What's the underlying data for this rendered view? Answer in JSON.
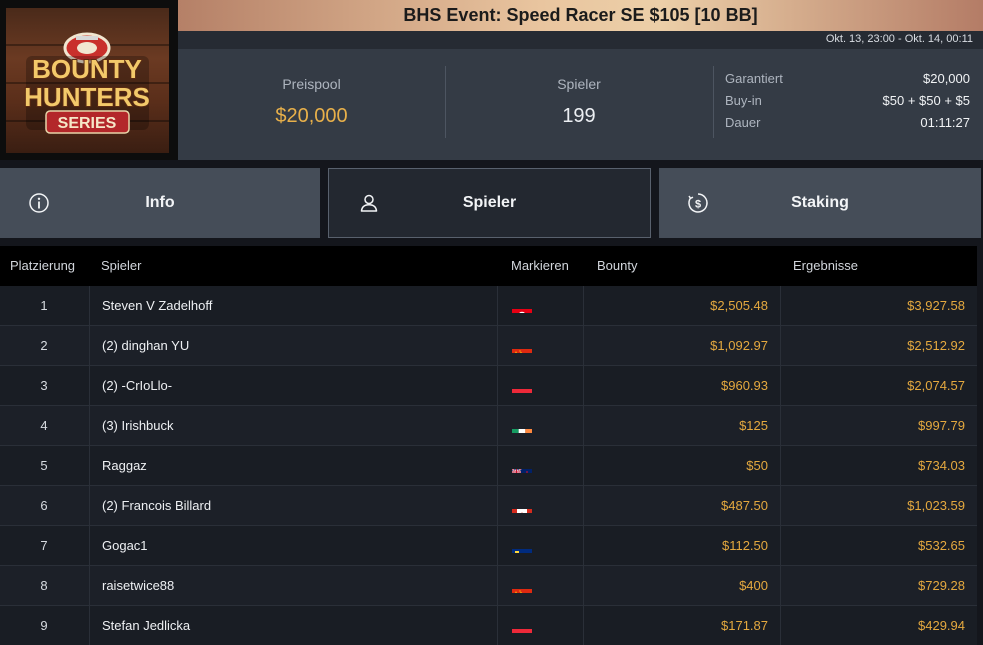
{
  "logo": {
    "line1": "BOUNTY",
    "line2": "HUNTERS",
    "line3": "SERIES"
  },
  "header": {
    "title": "BHS Event: Speed Racer SE $105 [10 BB]",
    "date_range": "Okt. 13, 23:00 - Okt. 14, 00:11"
  },
  "summary": {
    "prizepool_label": "Preispool",
    "prizepool_value": "$20,000",
    "players_label": "Spieler",
    "players_value": "199",
    "details": [
      {
        "label": "Garantiert",
        "value": "$20,000"
      },
      {
        "label": "Buy-in",
        "value": "$50 + $50 + $5"
      },
      {
        "label": "Dauer",
        "value": "01:11:27"
      }
    ]
  },
  "tabs": [
    {
      "label": "Info",
      "icon": "info-icon",
      "active": false
    },
    {
      "label": "Spieler",
      "icon": "user-icon",
      "active": true
    },
    {
      "label": "Staking",
      "icon": "dollar-coin-icon",
      "active": false
    }
  ],
  "table": {
    "headers": [
      "Platzierung",
      "Spieler",
      "Markieren",
      "Bounty",
      "Ergebnisse"
    ],
    "rows": [
      {
        "place": "1",
        "name": "Steven V Zadelhoff",
        "flag": "tn",
        "bounty": "$2,505.48",
        "result": "$3,927.58"
      },
      {
        "place": "2",
        "name": "(2) dinghan YU",
        "flag": "cn",
        "bounty": "$1,092.97",
        "result": "$2,512.92"
      },
      {
        "place": "3",
        "name": "(2) -CrIoLlo-",
        "flag": "at",
        "bounty": "$960.93",
        "result": "$2,074.57"
      },
      {
        "place": "4",
        "name": "(3) Irishbuck",
        "flag": "ie",
        "bounty": "$125",
        "result": "$997.79"
      },
      {
        "place": "5",
        "name": "Raggaz",
        "flag": "nz",
        "bounty": "$50",
        "result": "$734.03"
      },
      {
        "place": "6",
        "name": "(2) Francois Billard",
        "flag": "ca",
        "bounty": "$487.50",
        "result": "$1,023.59"
      },
      {
        "place": "7",
        "name": "Gogac1",
        "flag": "li",
        "bounty": "$112.50",
        "result": "$532.65"
      },
      {
        "place": "8",
        "name": "raisetwice88",
        "flag": "cn",
        "bounty": "$400",
        "result": "$729.28"
      },
      {
        "place": "9",
        "name": "Stefan Jedlicka",
        "flag": "at",
        "bounty": "$171.87",
        "result": "$429.94"
      }
    ]
  },
  "colors": {
    "accent_gold": "#e5a93f",
    "active_tab": "#232830",
    "tab": "#454d58"
  }
}
